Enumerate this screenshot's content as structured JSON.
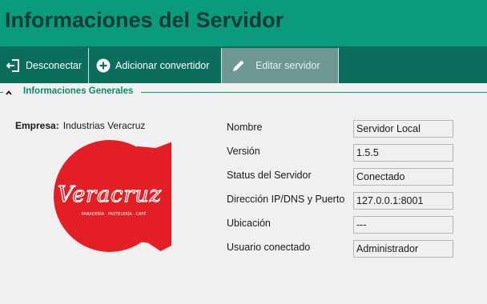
{
  "header": {
    "title": "Informaciones del Servidor"
  },
  "toolbar": {
    "disconnect_label": "Desconectar",
    "add_converter_label": "Adicionar convertidor",
    "edit_server_label": "Editar servidor"
  },
  "section": {
    "title": "Informaciones Generales"
  },
  "company": {
    "label": "Empresa:",
    "value": "Industrias  Veracruz"
  },
  "logo": {
    "name": "Veracruz",
    "tagline": "PANADERÍA · PASTELERÍA · CAFÉ"
  },
  "fields": [
    {
      "label": "Nombre",
      "value": "Servidor Local"
    },
    {
      "label": "Versión",
      "value": "1.5.5"
    },
    {
      "label": "Status del Servidor",
      "value": "Conectado"
    },
    {
      "label": "Dirección IP/DNS y Puerto",
      "value": "127.0.0.1:8001"
    },
    {
      "label": "Ubicación",
      "value": "---"
    },
    {
      "label": "Usuario conectado",
      "value": "Administrador"
    }
  ],
  "colors": {
    "header_bg": "#0a9b7d",
    "toolbar_bg": "#0b6e5c",
    "title_text": "#0d3b33",
    "logo_red": "#e31e24"
  },
  "icons": [
    "logout-icon",
    "add-circle-icon",
    "pencil-icon",
    "chevron-up-icon"
  ]
}
